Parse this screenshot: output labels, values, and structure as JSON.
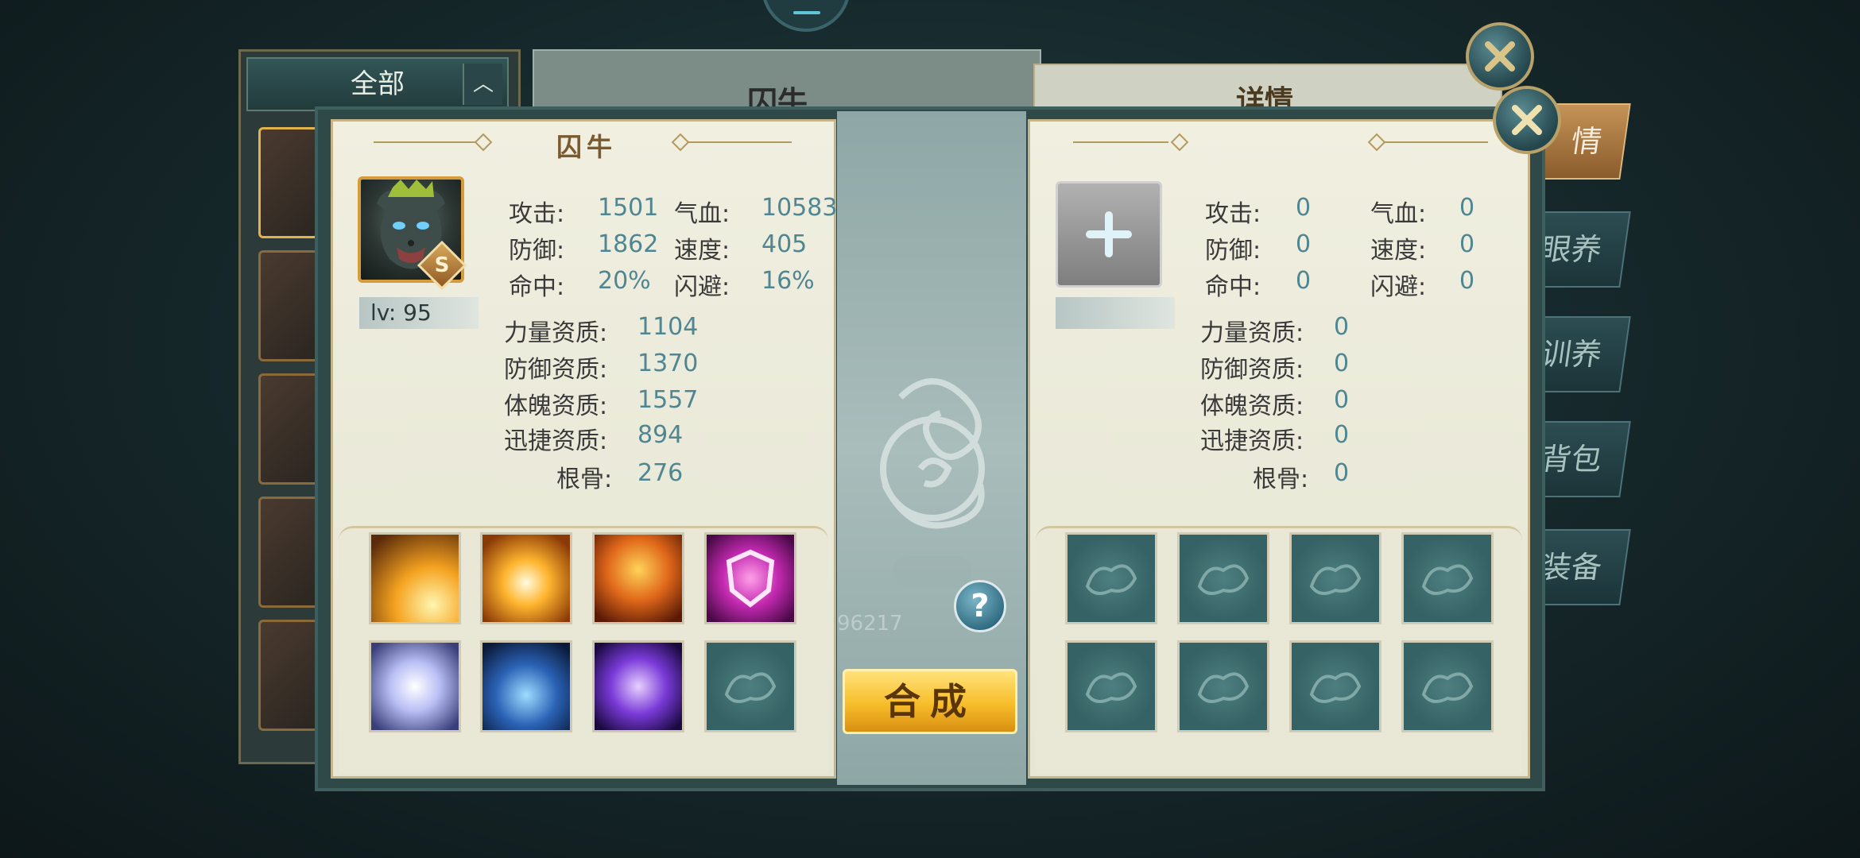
{
  "background": {
    "filter_label": "全部",
    "panel_title": "囚牛",
    "detail_title": "详情",
    "side_tabs": [
      "情",
      "眼养",
      "训养",
      "背包",
      "装备"
    ]
  },
  "left_panel": {
    "title": "囚牛",
    "level_label": "lv: 95",
    "rank_badge": "S",
    "stats": {
      "attack_label": "攻击:",
      "attack": "1501",
      "hp_label": "气血:",
      "hp": "10583",
      "defense_label": "防御:",
      "defense": "1862",
      "speed_label": "速度:",
      "speed": "405",
      "hit_label": "命中:",
      "hit": "20%",
      "dodge_label": "闪避:",
      "dodge": "16%"
    },
    "aptitudes": [
      {
        "label": "力量资质:",
        "value": "1104"
      },
      {
        "label": "防御资质:",
        "value": "1370"
      },
      {
        "label": "体魄资质:",
        "value": "1557"
      },
      {
        "label": "迅捷资质:",
        "value": "894"
      },
      {
        "label": "根骨:",
        "value": "276"
      }
    ],
    "skills": [
      "golden-slash-icon",
      "golden-burst-icon",
      "fire-shield-icon",
      "purple-shield-icon",
      "whirlwind-icon",
      "ice-shards-icon",
      "arcane-sweep-icon",
      "empty"
    ]
  },
  "right_panel": {
    "stats": {
      "attack_label": "攻击:",
      "attack": "0",
      "hp_label": "气血:",
      "hp": "0",
      "defense_label": "防御:",
      "defense": "0",
      "speed_label": "速度:",
      "speed": "0",
      "hit_label": "命中:",
      "hit": "0",
      "dodge_label": "闪避:",
      "dodge": "0"
    },
    "aptitudes": [
      {
        "label": "力量资质:",
        "value": "0"
      },
      {
        "label": "防御资质:",
        "value": "0"
      },
      {
        "label": "体魄资质:",
        "value": "0"
      },
      {
        "label": "迅捷资质:",
        "value": "0"
      },
      {
        "label": "根骨:",
        "value": "0"
      }
    ]
  },
  "center": {
    "compose_label": "合成",
    "help_label": "?",
    "faded_number": "96217"
  },
  "colors": {
    "value_teal": "#4f8692",
    "gold_button": "#f7bd2a",
    "paper": "#f0efe0"
  }
}
